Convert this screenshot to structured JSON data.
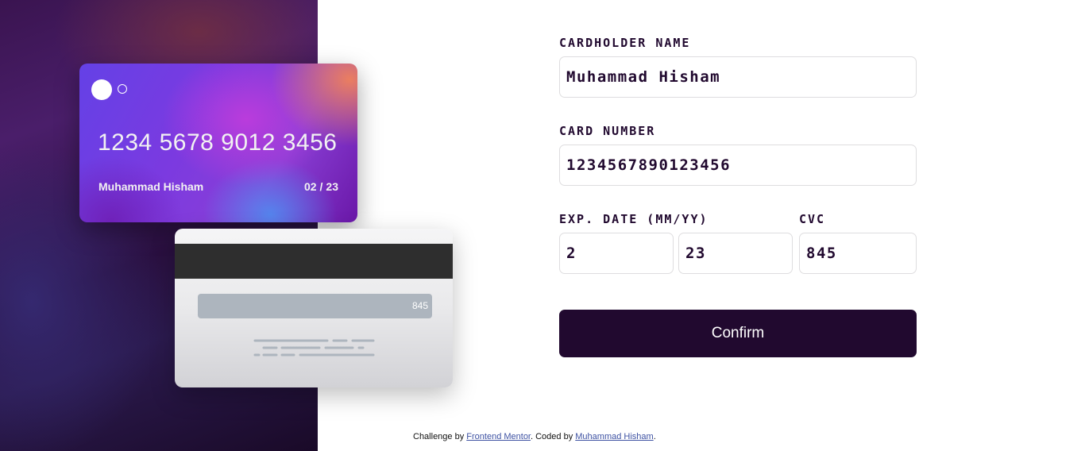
{
  "colors": {
    "dark_violet": "#21092f",
    "input_border": "#dedddf",
    "link": "#3e52a3",
    "white": "#ffffff"
  },
  "card_front": {
    "logo": "card-logo-circles",
    "number": "1234 5678 9012 3456",
    "holder_name": "Muhammad Hisham",
    "exp_month": "02",
    "exp_separator": "/",
    "exp_year": "23"
  },
  "card_back": {
    "cvc": "845"
  },
  "form": {
    "cardholder_label": "CARDHOLDER NAME",
    "cardholder_value": "Muhammad Hisham",
    "card_number_label": "CARD NUMBER",
    "card_number_value": "1234567890123456",
    "exp_label": "EXP. DATE (MM/YY)",
    "exp_month_value": "2",
    "exp_year_value": "23",
    "cvc_label": "CVC",
    "cvc_value": "845",
    "confirm_label": "Confirm"
  },
  "footer": {
    "prefix": "Challenge by ",
    "link1": "Frontend Mentor",
    "middle": ". Coded by ",
    "link2": "Muhammad Hisham",
    "suffix": "."
  }
}
